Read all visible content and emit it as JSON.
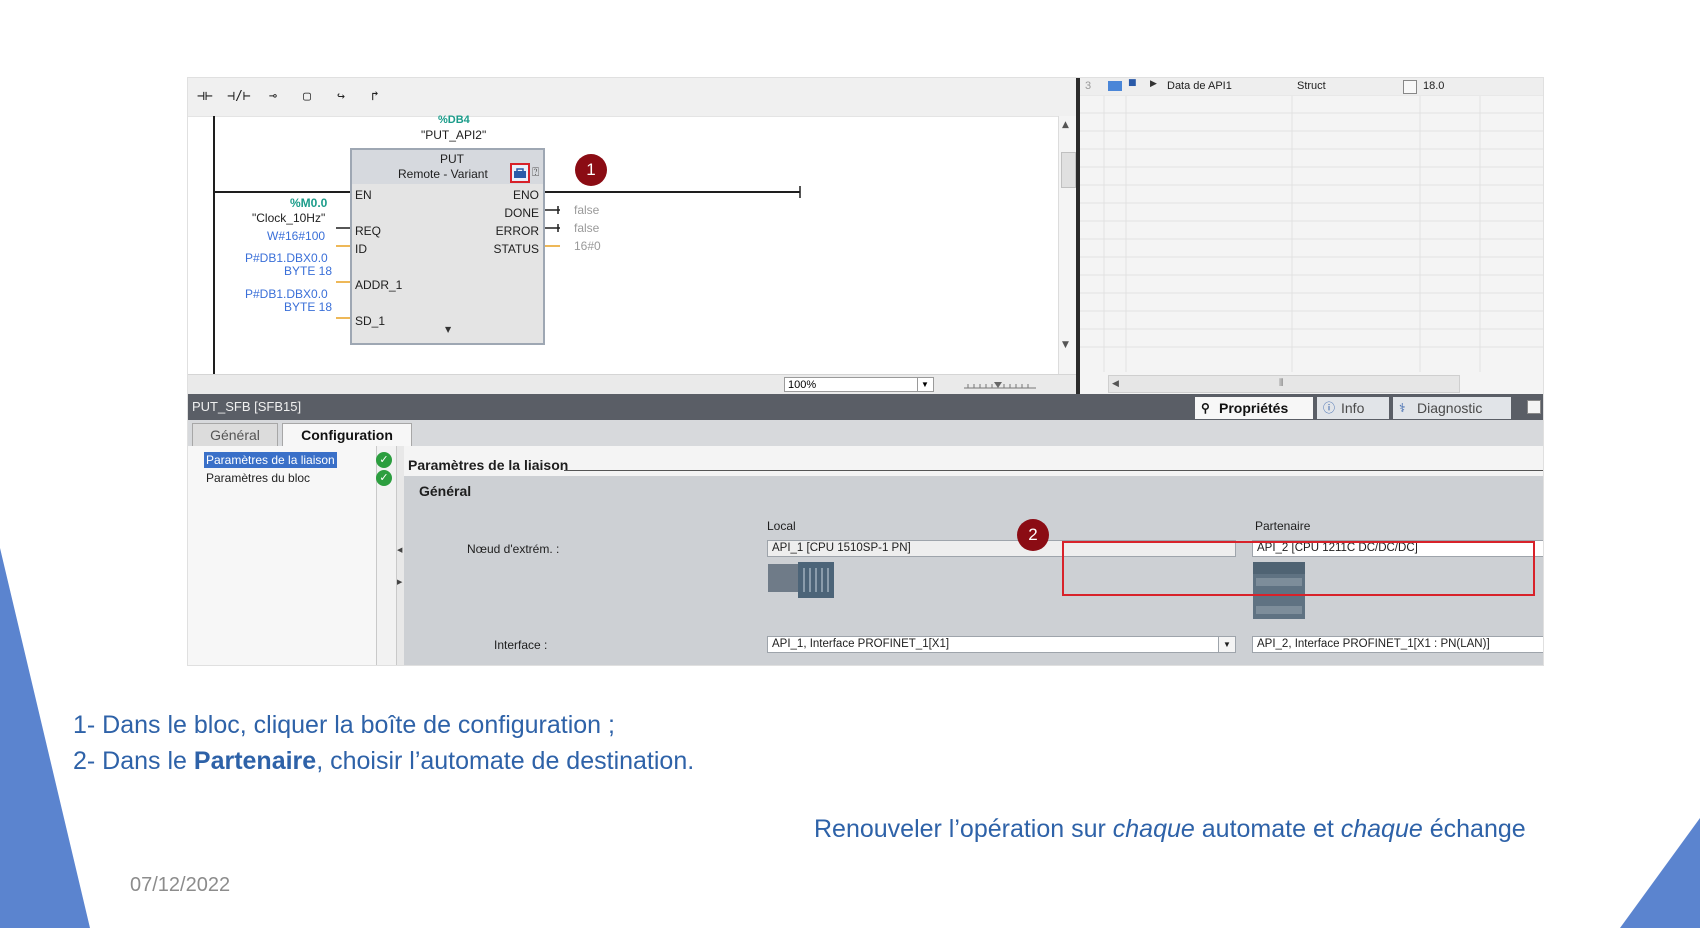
{
  "toolbar": {
    "icons": [
      "no-contact-icon",
      "nc-contact-icon",
      "coil-icon",
      "empty-box-icon",
      "open-branch-icon",
      "close-branch-icon"
    ],
    "glyphs": [
      "⊣⊢",
      "⊣/⊢",
      "⊸",
      "▢",
      "↪",
      "↱"
    ]
  },
  "ladder": {
    "db_partial": "%DB4",
    "db_name": "\"PUT_API2\"",
    "block_name": "PUT",
    "block_subtitle": "Remote  -  Variant",
    "pins_left": [
      "EN",
      "REQ",
      "ID",
      "ADDR_1",
      "SD_1"
    ],
    "pins_right": [
      "ENO",
      "DONE",
      "ERROR",
      "STATUS"
    ],
    "req_address": "%M0.0",
    "req_symbol": "\"Clock_10Hz\"",
    "id_value": "W#16#100",
    "addr1_line1": "P#DB1.DBX0.0",
    "addr1_line2": "BYTE 18",
    "sd1_line1": "P#DB1.DBX0.0",
    "sd1_line2": "BYTE 18",
    "done_value": "false",
    "error_value": "false",
    "status_value": "16#0",
    "zoom": "100%"
  },
  "data_panel": {
    "row_number": "3",
    "row_name": "Data de API1",
    "row_type": "Struct",
    "row_offset": "18.0"
  },
  "inspector": {
    "title": "PUT_SFB [SFB15]",
    "panel_tabs": [
      "Propriétés",
      "Info",
      "Diagnostic"
    ],
    "tabs": [
      "Général",
      "Configuration"
    ],
    "nav": [
      "Paramètres de la liaison",
      "Paramètres du bloc"
    ],
    "section_title": "Paramètres de la liaison",
    "group_title": "Général",
    "local_label": "Local",
    "partner_label": "Partenaire",
    "node_label": "Nœud d'extrém. :",
    "local_node": "API_1 [CPU 1510SP-1 PN]",
    "partner_node": "API_2 [CPU 1211C DC/DC/DC]",
    "interface_label": "Interface :",
    "local_interface": "API_1, Interface PROFINET_1[X1]",
    "partner_interface": "API_2, Interface PROFINET_1[X1 : PN(LAN)]"
  },
  "badges": [
    "1",
    "2"
  ],
  "instructions": {
    "line1": "1- Dans le bloc, cliquer la boîte de configuration ;",
    "line2_prefix": "2- Dans le ",
    "line2_bold": "Partenaire",
    "line2_suffix": ", choisir l’automate de destination.",
    "line3_a": "Renouveler l’opération sur ",
    "line3_b": "chaque",
    "line3_c": " automate et ",
    "line3_d": "chaque",
    "line3_e": " échange"
  },
  "date": "07/12/2022",
  "colors": {
    "caption_blue": "#2e62a8",
    "badge_red": "#8b0c14",
    "highlight_red": "#d8222a",
    "deco_blue": "#5b84cf"
  }
}
